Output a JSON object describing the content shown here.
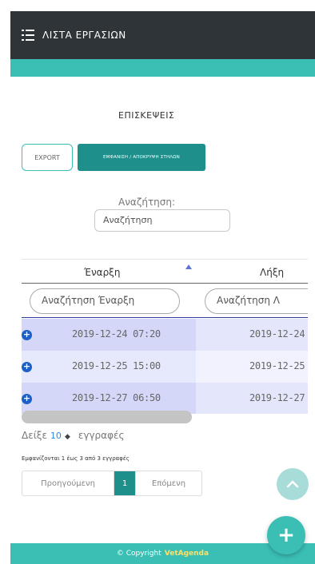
{
  "header": {
    "title": "ΛΙΣΤΑ ΕΡΓΑΣΙΩΝ",
    "menu_icon": "list-menu-icon",
    "bar_color": "#2f3438",
    "accent_color": "#3bbfb5"
  },
  "section": {
    "title": "ΕΠΙΣΚΕΨΕΙΣ"
  },
  "toolbar": {
    "export_label": "EXPORT",
    "columns_label": "ΕΜΦΑΝΙΣΗ / ΑΠΟΚΡΥΨΗ ΣΤΗΛΩΝ"
  },
  "search": {
    "label": "Αναζήτηση:",
    "placeholder": "Αναζήτηση"
  },
  "table": {
    "columns": [
      "Έναρξη",
      "Λήξη"
    ],
    "sorted_column": "Έναρξη",
    "sort_direction": "ascending",
    "filters": [
      "Αναζήτηση Έναρξη",
      "Αναζήτηση Λ"
    ],
    "rows": [
      {
        "start": "2019-12-24 07:20",
        "end": "2019-12-24"
      },
      {
        "start": "2019-12-25 15:00",
        "end": "2019-12-25"
      },
      {
        "start": "2019-12-27 06:50",
        "end": "2019-12-27"
      }
    ]
  },
  "length": {
    "prefix": "Δείξε",
    "value": "10",
    "suffix": "εγγραφές"
  },
  "info": "Εμφανίζονται 1 έως 3 από 3 εγγραφές",
  "pagination": {
    "prev": "Προηγούμενη",
    "current": "1",
    "next": "Επόμενη"
  },
  "fab": {
    "label": "+"
  },
  "footer": {
    "text": "© Copyright",
    "brand": "VetAgenda"
  }
}
